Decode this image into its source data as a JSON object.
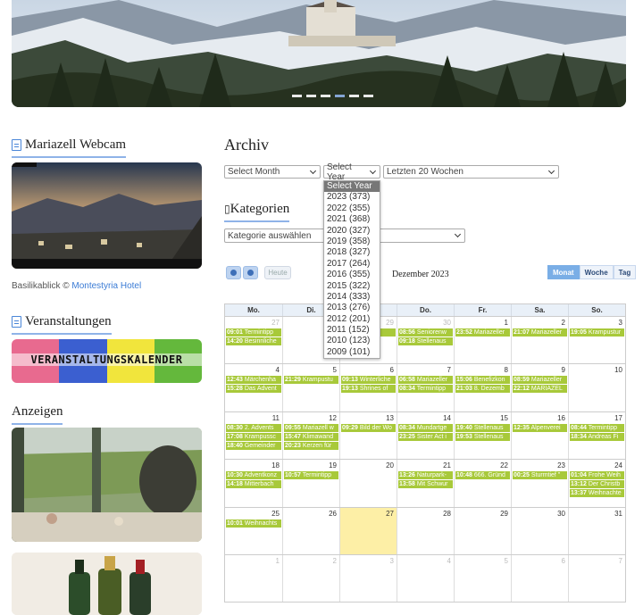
{
  "hero": {
    "slide_count": 6,
    "active_slide": 4
  },
  "sidebar": {
    "webcam_heading": "Mariazell Webcam",
    "webcam_caption_prefix": "Basilikablick © ",
    "webcam_caption_link": "Montestyria Hotel",
    "events_heading": "Veranstaltungen",
    "events_banner": "VERANSTALTUNGSKALENDER",
    "ads_heading": "Anzeigen"
  },
  "archive": {
    "heading": "Archiv",
    "month_select": "Select Month",
    "year_select": "Select Year",
    "weeks_select": "Letzten 20 Wochen",
    "year_options": [
      "Select Year",
      "2023  (373)",
      "2022  (355)",
      "2021  (368)",
      "2020  (327)",
      "2019  (358)",
      "2018  (327)",
      "2017  (264)",
      "2016  (355)",
      "2015  (322)",
      "2014  (333)",
      "2013  (276)",
      "2012  (201)",
      "2011  (152)",
      "2010  (123)",
      "2009  (101)"
    ]
  },
  "categories": {
    "heading": "Kategorien",
    "select": "Kategorie auswählen"
  },
  "calendar": {
    "today_label": "Heute",
    "title": "Dezember 2023",
    "views": [
      "Monat",
      "Woche",
      "Tag"
    ],
    "weekdays": [
      "Mo.",
      "Di.",
      "Mi.",
      "Do.",
      "Fr.",
      "Sa.",
      "So."
    ],
    "weeks": [
      [
        {
          "d": "27",
          "o": true,
          "ev": [
            [
              "09:01",
              "Termintipp"
            ],
            [
              "14:20",
              "Besinnliche"
            ]
          ]
        },
        {
          "d": "28",
          "o": true,
          "ev": []
        },
        {
          "d": "29",
          "o": true,
          "ev": [
            [
              "",
              "er Wo"
            ]
          ]
        },
        {
          "d": "30",
          "o": true,
          "ev": [
            [
              "08:56",
              "Seniorenw"
            ],
            [
              "09:18",
              "Stellenaus"
            ]
          ]
        },
        {
          "d": "1",
          "ev": [
            [
              "23:52",
              "Mariazeller"
            ]
          ]
        },
        {
          "d": "2",
          "ev": [
            [
              "21:07",
              "Mariazeller"
            ]
          ]
        },
        {
          "d": "3",
          "ev": [
            [
              "19:05",
              "Krampustur"
            ]
          ]
        }
      ],
      [
        {
          "d": "4",
          "ev": [
            [
              "12:43",
              "Märchenha"
            ],
            [
              "15:28",
              "Das Advent"
            ]
          ]
        },
        {
          "d": "5",
          "ev": [
            [
              "21:29",
              "Krampustu"
            ]
          ]
        },
        {
          "d": "6",
          "ev": [
            [
              "09:13",
              "Winterliche"
            ],
            [
              "19:13",
              "Shrines of"
            ]
          ]
        },
        {
          "d": "7",
          "ev": [
            [
              "06:58",
              "Mariazeller"
            ],
            [
              "08:34",
              "Termintipp"
            ]
          ]
        },
        {
          "d": "8",
          "ev": [
            [
              "15:06",
              "Benefizkon"
            ],
            [
              "21:03",
              "8. Dezemb"
            ]
          ]
        },
        {
          "d": "9",
          "ev": [
            [
              "08:59",
              "Mariazeller"
            ],
            [
              "22:12",
              "MARIAZEL"
            ]
          ]
        },
        {
          "d": "10",
          "ev": []
        }
      ],
      [
        {
          "d": "11",
          "ev": [
            [
              "08:30",
              "2. Advents"
            ],
            [
              "17:08",
              "Krampussc"
            ],
            [
              "18:40",
              "Gemeinder"
            ]
          ]
        },
        {
          "d": "12",
          "ev": [
            [
              "09:55",
              "Mariazell w"
            ],
            [
              "15:47",
              "Klimawand"
            ],
            [
              "20:23",
              "Kerzen für"
            ]
          ]
        },
        {
          "d": "13",
          "ev": [
            [
              "09:29",
              "Bild der Wo"
            ]
          ]
        },
        {
          "d": "14",
          "ev": [
            [
              "08:34",
              "Mundartge"
            ],
            [
              "23:25",
              "Sister Act i"
            ]
          ]
        },
        {
          "d": "15",
          "ev": [
            [
              "19:40",
              "Stellenaus"
            ],
            [
              "19:53",
              "Stellenaus"
            ]
          ]
        },
        {
          "d": "16",
          "ev": [
            [
              "12:35",
              "Alpenverei"
            ]
          ]
        },
        {
          "d": "17",
          "ev": [
            [
              "08:44",
              "Termintipp"
            ],
            [
              "18:34",
              "Andreas Fi"
            ]
          ]
        }
      ],
      [
        {
          "d": "18",
          "ev": [
            [
              "10:30",
              "Adventkonz"
            ],
            [
              "14:18",
              "Mitterbach"
            ]
          ]
        },
        {
          "d": "19",
          "ev": [
            [
              "10:57",
              "Termintipp"
            ]
          ]
        },
        {
          "d": "20",
          "ev": []
        },
        {
          "d": "21",
          "ev": [
            [
              "13:26",
              "Naturpark-"
            ],
            [
              "13:58",
              "Mit Schwur"
            ]
          ]
        },
        {
          "d": "22",
          "ev": [
            [
              "10:48",
              "666. Gründ"
            ]
          ]
        },
        {
          "d": "23",
          "ev": [
            [
              "00:25",
              "Sturmtief \""
            ]
          ]
        },
        {
          "d": "24",
          "ev": [
            [
              "01:04",
              "Frohe Weih"
            ],
            [
              "13:12",
              "Der Christb"
            ],
            [
              "13:37",
              "Weihnachte"
            ]
          ]
        }
      ],
      [
        {
          "d": "25",
          "ev": [
            [
              "10:01",
              "Weihnachts"
            ]
          ]
        },
        {
          "d": "26",
          "ev": []
        },
        {
          "d": "27",
          "today": true,
          "ev": []
        },
        {
          "d": "28",
          "ev": []
        },
        {
          "d": "29",
          "ev": []
        },
        {
          "d": "30",
          "ev": []
        },
        {
          "d": "31",
          "ev": []
        }
      ],
      [
        {
          "d": "1",
          "o": true,
          "ev": []
        },
        {
          "d": "2",
          "o": true,
          "ev": []
        },
        {
          "d": "3",
          "o": true,
          "ev": []
        },
        {
          "d": "4",
          "o": true,
          "ev": []
        },
        {
          "d": "5",
          "o": true,
          "ev": []
        },
        {
          "d": "6",
          "o": true,
          "ev": []
        },
        {
          "d": "7",
          "o": true,
          "ev": []
        }
      ]
    ]
  },
  "colors": {
    "accent": "#8fb3e8",
    "event": "#a8c93a",
    "today": "#fdefa6"
  }
}
